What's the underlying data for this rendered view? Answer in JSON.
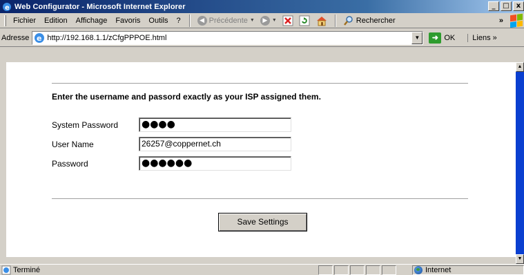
{
  "window": {
    "title": "Web Configurator - Microsoft Internet Explorer",
    "buttons": {
      "minimize": "_",
      "maximize": "□",
      "close": "x"
    }
  },
  "menu": {
    "items": [
      {
        "label": "Fichier"
      },
      {
        "label": "Edition"
      },
      {
        "label": "Affichage"
      },
      {
        "label": "Favoris"
      },
      {
        "label": "Outils"
      },
      {
        "label": "?"
      }
    ]
  },
  "toolbar": {
    "back_label": "Précédente",
    "search_label": "Rechercher",
    "chevron": "»"
  },
  "address": {
    "label": "Adresse",
    "url": "http://192.168.1.1/zCfgPPPOE.html",
    "go_label": "OK",
    "links_label": "Liens",
    "links_chevron": "»"
  },
  "form": {
    "heading": "Enter the username and passord exactly as your ISP assigned them.",
    "fields": [
      {
        "label": "System Password",
        "value": "●●●●",
        "masked": true
      },
      {
        "label": "User Name",
        "value": "26257@coppernet.ch",
        "masked": false
      },
      {
        "label": "Password",
        "value": "●●●●●●",
        "masked": true
      }
    ],
    "submit_label": "Save Settings"
  },
  "status": {
    "text": "Terminé",
    "zone": "Internet"
  },
  "icons": {
    "app": "ie-icon",
    "back": "back-arrow-icon",
    "forward": "forward-arrow-icon",
    "stop": "stop-icon",
    "refresh": "refresh-icon",
    "home": "home-icon",
    "search": "search-icon",
    "windows": "windows-logo-icon",
    "go": "go-arrow-icon",
    "globe": "globe-icon"
  },
  "colors": {
    "titlebar": "#0a246a",
    "chrome": "#d4d0c8",
    "scrollbar": "#0a3fd0"
  }
}
